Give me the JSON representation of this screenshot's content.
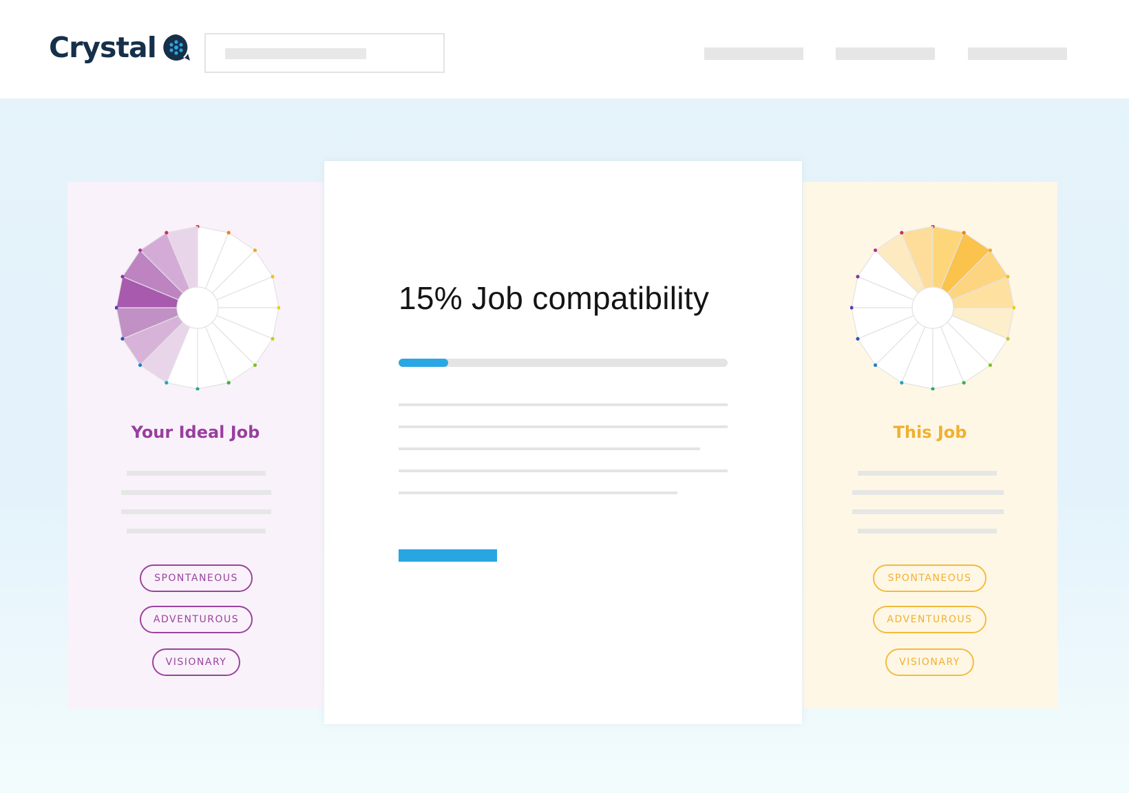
{
  "app": {
    "name": "Crystal"
  },
  "header": {
    "logo_text": "Crystal",
    "logo_icon": "crystal-flower-chat-icon",
    "search": {
      "placeholder": ""
    },
    "nav_items": [
      "",
      "",
      ""
    ]
  },
  "left_panel": {
    "title": "Your Ideal Job",
    "accent_color": "#983f9f",
    "tags": [
      "SPONTANEOUS",
      "ADVENTUROUS",
      "VISIONARY"
    ]
  },
  "right_panel": {
    "title": "This Job",
    "accent_color": "#f0b02f",
    "tags": [
      "SPONTANEOUS",
      "ADVENTUROUS",
      "VISIONARY"
    ]
  },
  "center": {
    "compatibility_title": "15% Job compatibility",
    "compatibility_percent": 15,
    "accent_color": "#2aa7e2"
  }
}
